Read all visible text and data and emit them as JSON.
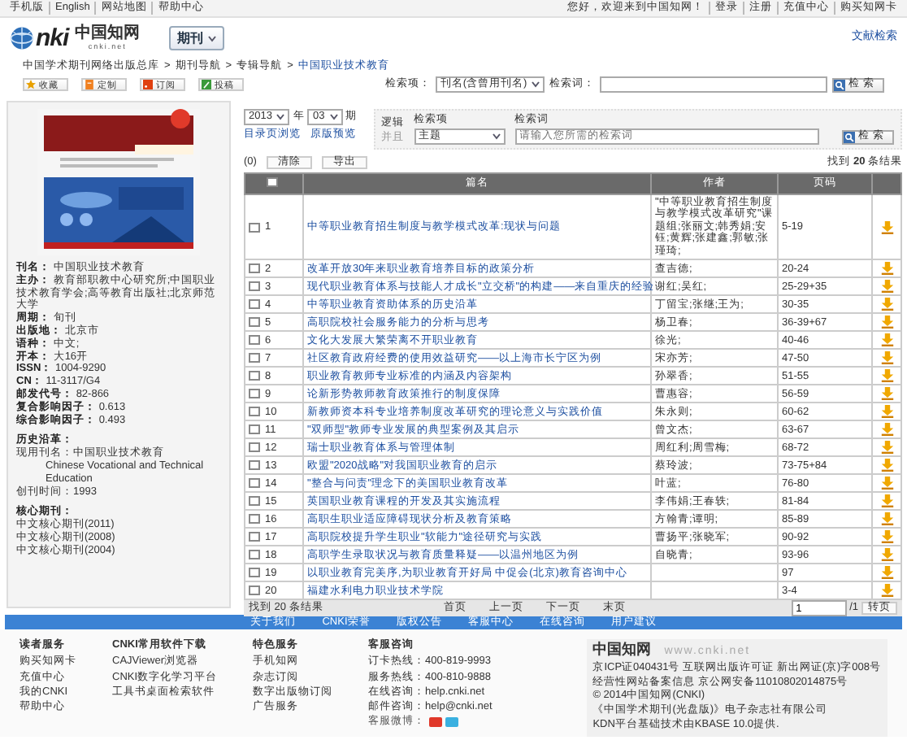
{
  "top_bar": {
    "left_links": [
      "手机版",
      "English",
      "网站地图",
      "帮助中心"
    ],
    "right_links": [
      "您好，欢迎来到中国知网！",
      "登录",
      "注册",
      "充值中心",
      "购买知网卡"
    ]
  },
  "header": {
    "logo": {
      "wordmark": "nki",
      "name": "中国知网",
      "domain": "cnki.net"
    },
    "channel": "期刊",
    "right_link": "文献检索"
  },
  "breadcrumb": {
    "separator": ">",
    "items": [
      "中国学术期刊网络出版总库",
      "期刊导航",
      "专辑导航",
      "中国职业技术教育"
    ]
  },
  "toolbar": {
    "buttons": [
      {
        "label": "收藏",
        "kind": "favorite"
      },
      {
        "label": "定制",
        "kind": "custom"
      },
      {
        "label": "订阅",
        "kind": "rss"
      },
      {
        "label": "投稿",
        "kind": "submit"
      }
    ]
  },
  "search": {
    "field_label": "检索项：",
    "field_value": "刊名(含曾用刊名)",
    "term_label": "检索词：",
    "button": "检 索"
  },
  "journal": {
    "info": [
      {
        "label": "刊名：",
        "value": "中国职业技术教育"
      },
      {
        "label": "主办：",
        "value": "教育部职教中心研究所;中国职业技术教育学会;高等教育出版社;北京师范大学"
      },
      {
        "label": "周期：",
        "value": "旬刊"
      },
      {
        "label": "出版地：",
        "value": "北京市"
      },
      {
        "label": "语种：",
        "value": "中文;"
      },
      {
        "label": "开本：",
        "value": "大16开"
      },
      {
        "label": "ISSN：",
        "value": "1004-9290"
      },
      {
        "label": "CN：",
        "value": "11-3117/G4"
      },
      {
        "label": "邮发代号：",
        "value": "82-866"
      },
      {
        "label": "复合影响因子：",
        "value": "0.613"
      },
      {
        "label": "综合影响因子：",
        "value": "0.493"
      }
    ],
    "history": {
      "title": "历史沿革：",
      "lines": [
        {
          "text": "现用刊名：中国职业技术教育",
          "indent": false
        },
        {
          "text": "Chinese Vocational and Technical Education",
          "indent": true
        },
        {
          "text": "创刊时间：1993",
          "indent": false
        }
      ]
    },
    "core": {
      "title": "核心期刊：",
      "items": [
        "中文核心期刊(2011)",
        "中文核心期刊(2008)",
        "中文核心期刊(2004)"
      ]
    }
  },
  "issue_filter": {
    "year": "2013",
    "year_unit": "年",
    "issue": "03",
    "issue_unit": "期",
    "links": [
      "目录页浏览",
      "原版预览"
    ]
  },
  "article_search": {
    "logic_label": "逻辑",
    "logic_value": "并且",
    "logic_disabled": true,
    "field_label": "检索项",
    "field_value": "主题",
    "term_label": "检索词",
    "placeholder": "请输入您所需的检索词",
    "button": "检 索"
  },
  "actions": {
    "count": "(0)",
    "buttons": [
      "清除",
      "导出"
    ],
    "result": "找到 **20** 条结果"
  },
  "table": {
    "columns": [
      "篇名",
      "作者",
      "页码"
    ],
    "header_checked": false,
    "rows": [
      {
        "no": "1",
        "title": "中等职业教育招生制度与教学模式改革:现状与问题",
        "authors": "\"中等职业教育招生制度与教学模式改革研究\"课题组;张丽文;韩秀娟;安钰;黄辉;张建鑫;郭敏;张瑾琦;",
        "pages": "5-19",
        "checked": false
      },
      {
        "no": "2",
        "title": "改革开放30年来职业教育培养目标的政策分析",
        "authors": "查吉德;",
        "pages": "20-24",
        "checked": false
      },
      {
        "no": "3",
        "title": "现代职业教育体系与技能人才成长\"立交桥\"的构建——来自重庆的经验",
        "authors": "谢红;吴红;",
        "pages": "25-29+35",
        "checked": false
      },
      {
        "no": "4",
        "title": "中等职业教育资助体系的历史沿革",
        "authors": "丁留宝;张继;王为;",
        "pages": "30-35",
        "checked": false
      },
      {
        "no": "5",
        "title": "高职院校社会服务能力的分析与思考",
        "authors": "杨卫春;",
        "pages": "36-39+67",
        "checked": false
      },
      {
        "no": "6",
        "title": "文化大发展大繁荣离不开职业教育",
        "authors": "徐光;",
        "pages": "40-46",
        "checked": false
      },
      {
        "no": "7",
        "title": "社区教育政府经费的使用效益研究——以上海市长宁区为例",
        "authors": "宋亦芳;",
        "pages": "47-50",
        "checked": false
      },
      {
        "no": "8",
        "title": "职业教育教师专业标准的内涵及内容架构",
        "authors": "孙翠香;",
        "pages": "51-55",
        "checked": false
      },
      {
        "no": "9",
        "title": "论新形势教师教育政策推行的制度保障",
        "authors": "曹惠容;",
        "pages": "56-59",
        "checked": false
      },
      {
        "no": "10",
        "title": "新教师资本科专业培养制度改革研究的理论意义与实践价值",
        "authors": "朱永则;",
        "pages": "60-62",
        "checked": false
      },
      {
        "no": "11",
        "title": "\"双师型\"教师专业发展的典型案例及其启示",
        "authors": "曾文杰;",
        "pages": "63-67",
        "checked": false
      },
      {
        "no": "12",
        "title": "瑞士职业教育体系与管理体制",
        "authors": "周红利;周雪梅;",
        "pages": "68-72",
        "checked": false
      },
      {
        "no": "13",
        "title": "欧盟\"2020战略\"对我国职业教育的启示",
        "authors": "蔡玲波;",
        "pages": "73-75+84",
        "checked": false
      },
      {
        "no": "14",
        "title": "\"整合与问责\"理念下的美国职业教育改革",
        "authors": "叶蓝;",
        "pages": "76-80",
        "checked": false
      },
      {
        "no": "15",
        "title": "英国职业教育课程的开发及其实施流程",
        "authors": "李伟娟;王春轶;",
        "pages": "81-84",
        "checked": false
      },
      {
        "no": "16",
        "title": "高职生职业适应障碍现状分析及教育策略",
        "authors": "方翰青;谭明;",
        "pages": "85-89",
        "checked": false
      },
      {
        "no": "17",
        "title": "高职院校提升学生职业\"软能力\"途径研究与实践",
        "authors": "曹扬平;张晓军;",
        "pages": "90-92",
        "checked": false
      },
      {
        "no": "18",
        "title": "高职学生录取状况与教育质量释疑——以温州地区为例",
        "authors": "自晓青;",
        "pages": "93-96",
        "checked": false
      },
      {
        "no": "19",
        "title": "以职业教育完美序,为职业教育开好局 中促会(北京)教育咨询中心",
        "pages": "97",
        "checked": false
      },
      {
        "no": "20",
        "title": "福建水利电力职业技术学院",
        "pages": "3-4",
        "checked": false
      }
    ]
  },
  "pagination": {
    "result": "找到 20 条结果",
    "links": [
      "首页",
      "上一页",
      "下一页",
      "末页"
    ],
    "page": "1",
    "total": "/1",
    "button": "转页"
  },
  "footer": {
    "nav": [
      "关于我们",
      "CNKI荣誉",
      "版权公告",
      "客服中心",
      "在线咨询",
      "用户建议"
    ],
    "columns": [
      {
        "title": "读者服务",
        "items": [
          "购买知网卡",
          "充值中心",
          "我的CNKI",
          "帮助中心"
        ]
      },
      {
        "title": "CNKI常用软件下载",
        "items": [
          "CAJViewer浏览器",
          "CNKI数字化学习平台",
          "工具书桌面检索软件"
        ]
      },
      {
        "title": "特色服务",
        "items": [
          "手机知网",
          "杂志订阅",
          "数字出版物订阅",
          "广告服务"
        ]
      },
      {
        "title": "客服咨询",
        "items": [
          "订卡热线：400-819-9993",
          "服务热线：400-810-9888",
          "在线咨询：help.cnki.net",
          "邮件咨询：help@cnki.net"
        ]
      }
    ],
    "social_label": "客服微博：",
    "brand": {
      "name": "中国知网",
      "domain": "www.cnki.net"
    },
    "lines": [
      "京ICP证040431号 互联网出版许可证 新出网证(京)字008号",
      "经营性网站备案信息 京公网安备11010802014875号",
      "© 2014中国知网(CNKI)",
      "《中国学术期刊(光盘版)》电子杂志社有限公司",
      "KDN平台基础技术由KBASE 10.0提供."
    ]
  }
}
